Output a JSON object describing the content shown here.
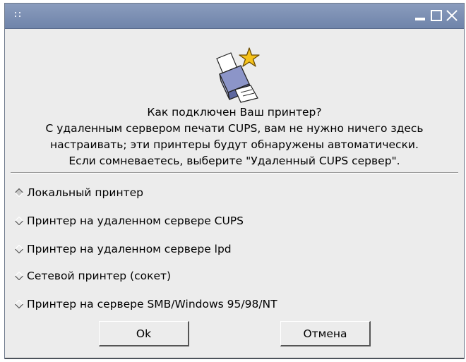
{
  "window": {
    "title": "",
    "controls": [
      "minimize-icon",
      "maximize-icon",
      "close-icon"
    ]
  },
  "dialog": {
    "icon": "printer-star-icon",
    "question": "Как подключен Ваш принтер?",
    "info_lines": [
      "С удаленным сервером печати CUPS, вам не нужно ничего здесь",
      "настраивать; эти принтеры будут обнаружены автоматически.",
      "Если сомневаетесь, выберите \"Удаленный CUPS сервер\"."
    ],
    "options": [
      {
        "label": "Локальный принтер",
        "selected": true
      },
      {
        "label": "Принтер на удаленном сервере CUPS",
        "selected": false
      },
      {
        "label": "Принтер на удаленном сервере lpd",
        "selected": false
      },
      {
        "label": "Сетевой принтер (сокет)",
        "selected": false
      },
      {
        "label": "Принтер на сервере SMB/Windows 95/98/NT",
        "selected": false
      }
    ],
    "buttons": {
      "ok": "Ok",
      "cancel": "Отмена"
    }
  },
  "colors": {
    "titlebar": "#7b8fb3",
    "window_bg": "#ececec"
  }
}
